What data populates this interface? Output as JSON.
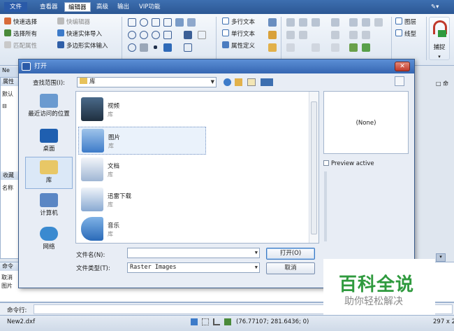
{
  "menubar": {
    "tabs": [
      "文件",
      "查看器",
      "编辑器",
      "高级",
      "输出",
      "VIP功能"
    ],
    "active_tab": "编辑器"
  },
  "ribbon": {
    "col1": [
      "快速选择",
      "选择所有",
      "匹配属性"
    ],
    "col2": [
      "快编辑器",
      "快速实体导入",
      "多边形实体输入"
    ],
    "col3": [
      "多行文本",
      "单行文本",
      "属性定义"
    ],
    "col4": [
      "图层",
      "线型"
    ],
    "capture_label": "捕捉"
  },
  "bg_panels": {
    "tab_label": "Ne",
    "attr_label": "属性",
    "default_label": "默认",
    "collect_label": "收藏",
    "name_label": "名称",
    "cmd_header": "命令",
    "log_lines": [
      "取消",
      "图片"
    ],
    "right_tab": "□ 命"
  },
  "dialog": {
    "title": "打开",
    "look_in_label": "查找范围(I):",
    "look_in_value": "库",
    "places": [
      "最近访问的位置",
      "桌面",
      "库",
      "计算机",
      "网络"
    ],
    "selected_place": "库",
    "files": [
      {
        "name": "视频",
        "sub": "库"
      },
      {
        "name": "图片",
        "sub": "库"
      },
      {
        "name": "文档",
        "sub": "库"
      },
      {
        "name": "迅雷下载",
        "sub": "库"
      },
      {
        "name": "音乐",
        "sub": "库"
      }
    ],
    "selected_file": "图片",
    "preview_text": "(None)",
    "preview_active_label": "Preview active",
    "filename_label": "文件名(N):",
    "filename_value": "",
    "filetype_label": "文件类型(T):",
    "filetype_value": "Raster Images",
    "open_label": "打开(O)",
    "cancel_label": "取消"
  },
  "command": {
    "label": "命令行:",
    "value": ""
  },
  "status": {
    "filename": "New2.dxf",
    "coords": "(76.77107; 281.6436; 0)",
    "size": "297 x 2"
  },
  "watermark": {
    "title": "百科全说",
    "subtitle": "助你轻松解决"
  },
  "colors": {
    "accent": "#3566b2",
    "watermark_green": "#2f9a3e"
  }
}
